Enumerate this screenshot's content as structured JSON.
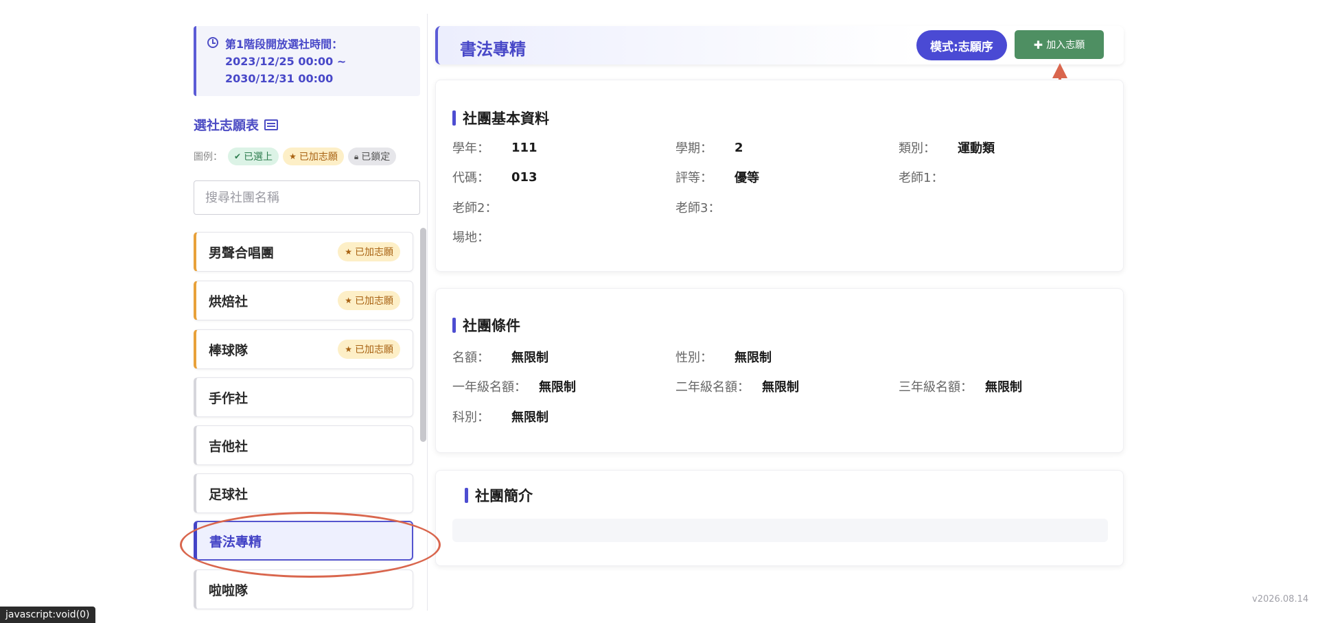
{
  "sidebar": {
    "notice": "第1階段開放選社時間：2023/12/25 00:00 ~ 2030/12/31 00:00",
    "wish_title": "選社志願表",
    "legend": {
      "label": "圖例：",
      "selected": "已選上",
      "wished": "已加志願",
      "locked": "已鎖定"
    },
    "search_placeholder": "搜尋社團名稱",
    "clubs": [
      {
        "name": "男聲合唱團",
        "badge": "已加志願"
      },
      {
        "name": "烘焙社",
        "badge": "已加志願"
      },
      {
        "name": "棒球隊",
        "badge": "已加志願"
      },
      {
        "name": "手作社"
      },
      {
        "name": "吉他社"
      },
      {
        "name": "足球社"
      },
      {
        "name": "書法專精"
      },
      {
        "name": "啦啦隊"
      }
    ]
  },
  "header": {
    "title": "書法專精",
    "mode": "模式:志願序",
    "add_label": "加入志願"
  },
  "basic": {
    "title": "社團基本資料",
    "year_label": "學年：",
    "year": "111",
    "term_label": "學期：",
    "term": "2",
    "category_label": "類別：",
    "category": "運動類",
    "code_label": "代碼：",
    "code": "013",
    "grade_label": "評等：",
    "grade": "優等",
    "teacher1_label": "老師1：",
    "teacher1": "",
    "teacher2_label": "老師2：",
    "teacher2": "",
    "teacher3_label": "老師3：",
    "teacher3": "",
    "venue_label": "場地：",
    "venue": ""
  },
  "conditions": {
    "title": "社團條件",
    "quota_label": "名額：",
    "quota": "無限制",
    "gender_label": "性別：",
    "gender": "無限制",
    "g1_label": "一年級名額：",
    "g1": "無限制",
    "g2_label": "二年級名額：",
    "g2": "無限制",
    "g3_label": "三年級名額：",
    "g3": "無限制",
    "dept_label": "科別：",
    "dept": "無限制"
  },
  "intro": {
    "title": "社團簡介"
  },
  "status_bar": "javascript:void(0)",
  "version": "v2026.08.14",
  "colors": {
    "accent": "#4a4ad4",
    "add_button": "#4e8f62",
    "wished": "#e8a13a",
    "annotation": "#d9664d"
  }
}
